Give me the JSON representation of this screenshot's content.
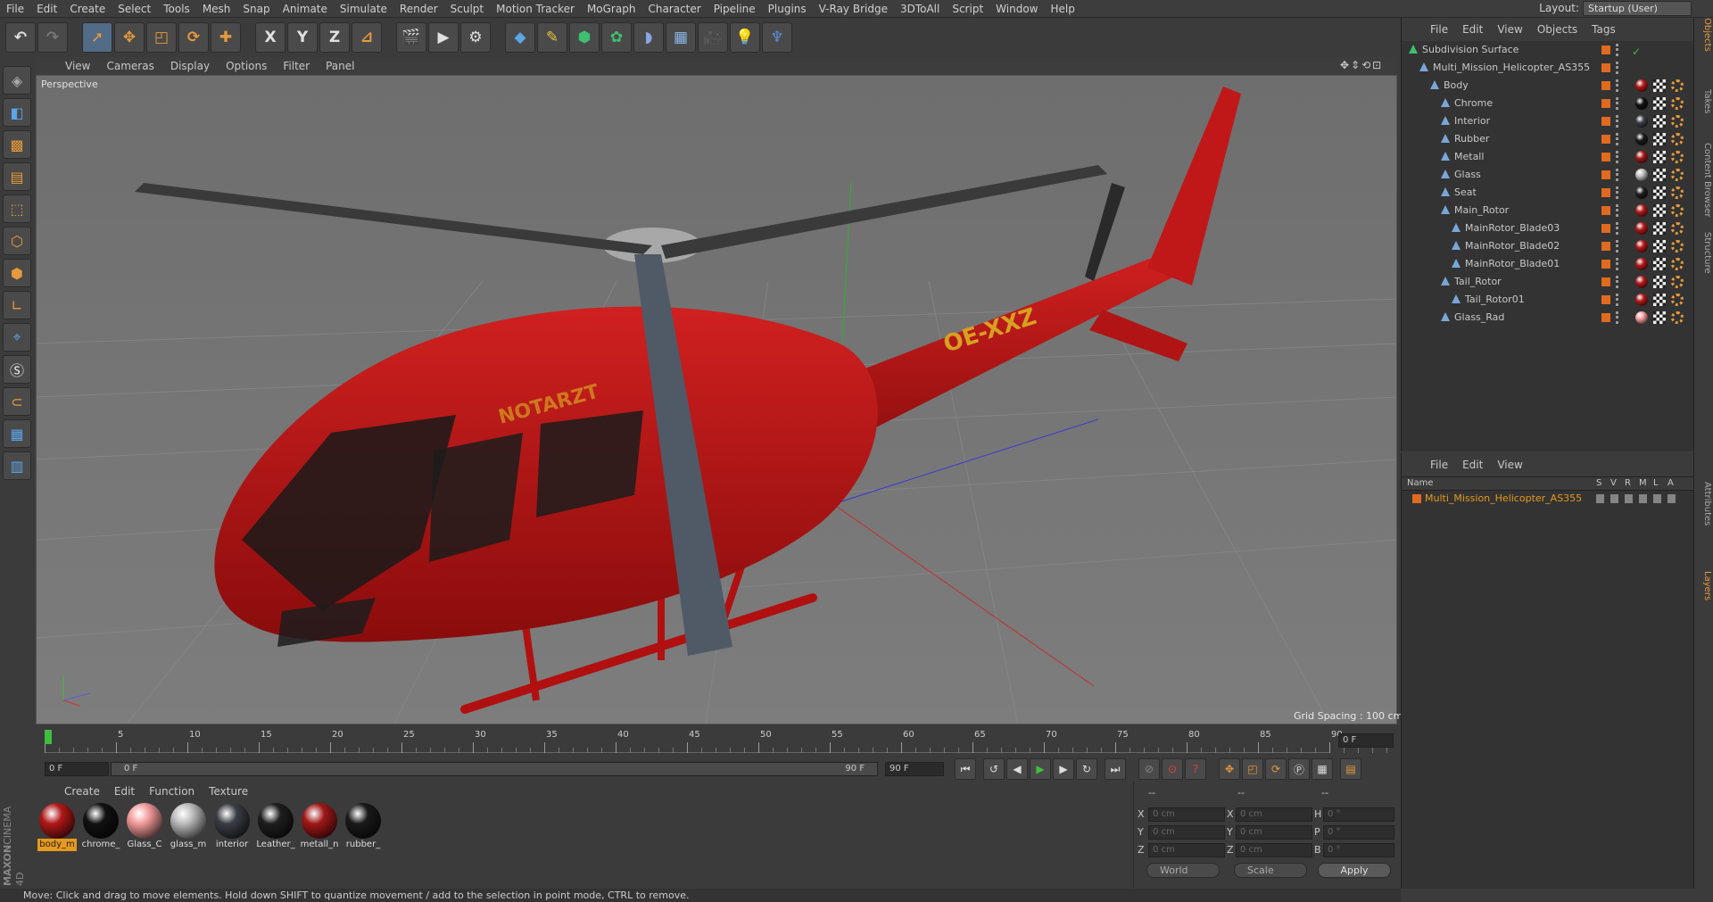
{
  "menubar": {
    "items": [
      "File",
      "Edit",
      "Create",
      "Select",
      "Tools",
      "Mesh",
      "Snap",
      "Animate",
      "Simulate",
      "Render",
      "Sculpt",
      "Motion Tracker",
      "MoGraph",
      "Character",
      "Pipeline",
      "Plugins",
      "V-Ray Bridge",
      "3DToAll",
      "Script",
      "Window",
      "Help"
    ],
    "layout_label": "Layout:",
    "layout_value": "Startup (User)"
  },
  "toolbar": {
    "icons": [
      "undo-icon",
      "redo-icon",
      "select-arrow-icon",
      "move-icon",
      "scale-icon",
      "rotate-icon",
      "add-icon",
      "axis-x-icon",
      "axis-y-icon",
      "axis-z-icon",
      "world-coord-icon",
      "render-view-icon",
      "render-queue-icon",
      "render-settings-icon",
      "cube-icon",
      "pen-icon",
      "subdivision-icon",
      "cloner-icon",
      "deformer-icon",
      "floor-icon",
      "camera-icon",
      "light-icon",
      "python-icon"
    ],
    "axis_x": "X",
    "axis_y": "Y",
    "axis_z": "Z"
  },
  "viewport": {
    "menu": [
      "View",
      "Cameras",
      "Display",
      "Options",
      "Filter",
      "Panel"
    ],
    "label": "Perspective",
    "grid_spacing": "Grid Spacing : 100 cm",
    "model_text": "OE-XXZ",
    "model_text2": "NOTARZT"
  },
  "timeline": {
    "ticks": [
      "0",
      "5",
      "10",
      "15",
      "20",
      "25",
      "30",
      "35",
      "40",
      "45",
      "50",
      "55",
      "60",
      "65",
      "70",
      "75",
      "80",
      "85",
      "90"
    ],
    "current_frame": "0 F"
  },
  "frames": {
    "start": "0 F",
    "range_start": "0 F",
    "range_end": "90 F",
    "end": "90 F"
  },
  "materials": {
    "menu": [
      "Create",
      "Edit",
      "Function",
      "Texture"
    ],
    "items": [
      {
        "name": "body_m",
        "color": "#b01818",
        "selected": true
      },
      {
        "name": "chrome_",
        "color": "#111111",
        "selected": false
      },
      {
        "name": "Glass_C",
        "color": "#f29a9a",
        "selected": false
      },
      {
        "name": "glass_m",
        "color": "#bbbbbb",
        "selected": false
      },
      {
        "name": "interior",
        "color": "#3a3d44",
        "selected": false
      },
      {
        "name": "Leather_",
        "color": "#1e1e1e",
        "selected": false
      },
      {
        "name": "metall_n",
        "color": "#a01818",
        "selected": false
      },
      {
        "name": "rubber_",
        "color": "#1a1a1a",
        "selected": false
      }
    ]
  },
  "coords": {
    "header": "--",
    "header2": "--",
    "header3": "--",
    "x": "X",
    "y": "Y",
    "z": "Z",
    "h": "H",
    "p": "P",
    "b": "B",
    "pos_x": "0 cm",
    "pos_y": "0 cm",
    "pos_z": "0 cm",
    "size_x": "0 cm",
    "size_y": "0 cm",
    "size_z": "0 cm",
    "rot_h": "0 °",
    "rot_p": "0 °",
    "rot_b": "0 °",
    "mode": "World",
    "transform": "Scale",
    "apply": "Apply"
  },
  "objects": {
    "menu": [
      "File",
      "Edit",
      "View",
      "Objects",
      "Tags"
    ],
    "items": [
      {
        "name": "Subdivision Surface",
        "indent": 0,
        "tag": "check",
        "tagcolor": "#3fbf3f"
      },
      {
        "name": "Multi_Mission_Helicopter_AS355",
        "indent": 1,
        "tag": "",
        "tagcolor": ""
      },
      {
        "name": "Body",
        "indent": 2,
        "tag": "mat",
        "tagcolor": "#b01818"
      },
      {
        "name": "Chrome",
        "indent": 3,
        "tag": "mat",
        "tagcolor": "#111111"
      },
      {
        "name": "Interior",
        "indent": 3,
        "tag": "mat",
        "tagcolor": "#3a3d44"
      },
      {
        "name": "Rubber",
        "indent": 3,
        "tag": "mat",
        "tagcolor": "#1a1a1a"
      },
      {
        "name": "Metall",
        "indent": 3,
        "tag": "mat",
        "tagcolor": "#a01818"
      },
      {
        "name": "Glass",
        "indent": 3,
        "tag": "mat",
        "tagcolor": "#bbbbbb"
      },
      {
        "name": "Seat",
        "indent": 3,
        "tag": "mat",
        "tagcolor": "#1e1e1e"
      },
      {
        "name": "Main_Rotor",
        "indent": 3,
        "tag": "mat",
        "tagcolor": "#b01818"
      },
      {
        "name": "MainRotor_Blade03",
        "indent": 4,
        "tag": "mat",
        "tagcolor": "#b01818"
      },
      {
        "name": "MainRotor_Blade02",
        "indent": 4,
        "tag": "mat",
        "tagcolor": "#b01818"
      },
      {
        "name": "MainRotor_Blade01",
        "indent": 4,
        "tag": "mat",
        "tagcolor": "#b01818"
      },
      {
        "name": "Tail_Rotor",
        "indent": 3,
        "tag": "mat",
        "tagcolor": "#b01818"
      },
      {
        "name": "Tail_Rotor01",
        "indent": 4,
        "tag": "mat",
        "tagcolor": "#b01818"
      },
      {
        "name": "Glass_Rad",
        "indent": 3,
        "tag": "mat",
        "tagcolor": "#f29a9a"
      }
    ]
  },
  "layers": {
    "menu": [
      "File",
      "Edit",
      "View"
    ],
    "col_name": "Name",
    "cols": [
      "S",
      "V",
      "R",
      "M",
      "L",
      "A"
    ],
    "items": [
      {
        "name": "Multi_Mission_Helicopter_AS355",
        "color": "#e06a1e"
      }
    ]
  },
  "sidetabs": {
    "items": [
      "Objects",
      "Takes",
      "Content Browser",
      "Structure",
      "Attributes",
      "Layers"
    ]
  },
  "status": {
    "text": "Move: Click and drag to move elements. Hold down SHIFT to quantize movement / add to the selection in point mode, CTRL to remove."
  },
  "brand": {
    "line1": "MAXON",
    "line2": "CINEMA 4D"
  }
}
